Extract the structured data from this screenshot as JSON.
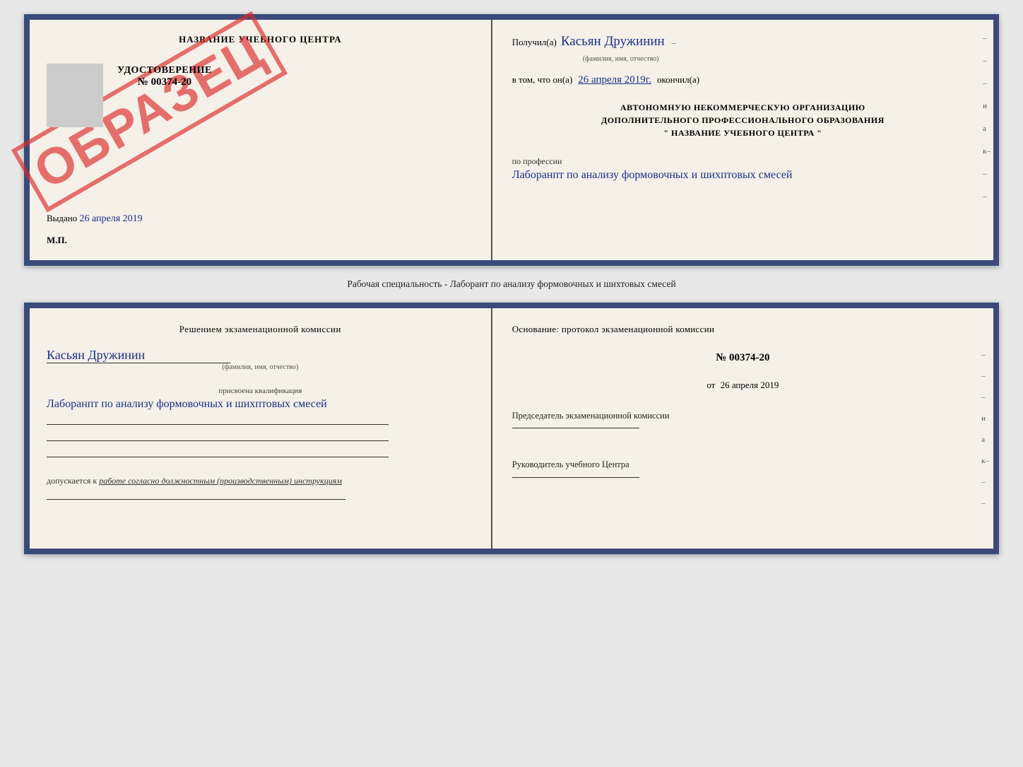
{
  "top_card": {
    "left": {
      "title": "НАЗВАНИЕ УЧЕБНОГО ЦЕНТРА",
      "stamp": "ОБРАЗЕЦ",
      "udostoverenie_label": "УДОСТОВЕРЕНИЕ",
      "number": "№ 00374-20",
      "vydano_label": "Выдано",
      "vydano_date": "26 апреля 2019",
      "mp": "М.П."
    },
    "right": {
      "poluchil_prefix": "Получил(а)",
      "name_handwritten": "Касьян Дружинин",
      "name_sublabel": "(фамилия, имя, отчество)",
      "vtom_prefix": "в том, что он(а)",
      "date_handwritten": "26 апреля 2019г.",
      "okonchil": "окончил(а)",
      "institution_line1": "АВТОНОМНУЮ НЕКОММЕРЧЕСКУЮ ОРГАНИЗАЦИЮ",
      "institution_line2": "ДОПОЛНИТЕЛЬНОГО ПРОФЕССИОНАЛЬНОГО ОБРАЗОВАНИЯ",
      "institution_line3": "\"  НАЗВАНИЕ УЧЕБНОГО ЦЕНТРА  \"",
      "po_professii": "по профессии",
      "profession_handwritten": "Лаборанпт по анализу формовочных и шихптовых смесей",
      "side_chars": [
        "–",
        "–",
        "–",
        "и",
        "ла",
        "к–",
        "–",
        "–"
      ]
    }
  },
  "specialty_label": "Рабочая специальность - Лаборант по анализу формовочных и шихтовых смесей",
  "bottom_card": {
    "left": {
      "komissia_text": "Решением  экзаменационной  комиссии",
      "name_handwritten": "Касьян Дружинин",
      "name_sublabel": "(фамилия, имя, отчество)",
      "prisvoena_label": "присвоена квалификация",
      "kvali_handwritten": "Лаборанпт по анализу формовочных и шихптовых смесей",
      "dopuskaetsya_label": "допускается к",
      "dopuskaetsya_value": "работе согласно должностным (производственным) инструкциям"
    },
    "right": {
      "osnovaniye_text": "Основание: протокол экзаменационной  комиссии",
      "protocol_number": "№  00374-20",
      "ot_label": "от",
      "protocol_date": "26 апреля 2019",
      "predsedatel_label": "Председатель экзаменационной комиссии",
      "rukovoditel_label": "Руководитель учебного Центра",
      "side_chars": [
        "–",
        "–",
        "–",
        "и",
        "ла",
        "к–",
        "–",
        "–"
      ]
    }
  }
}
